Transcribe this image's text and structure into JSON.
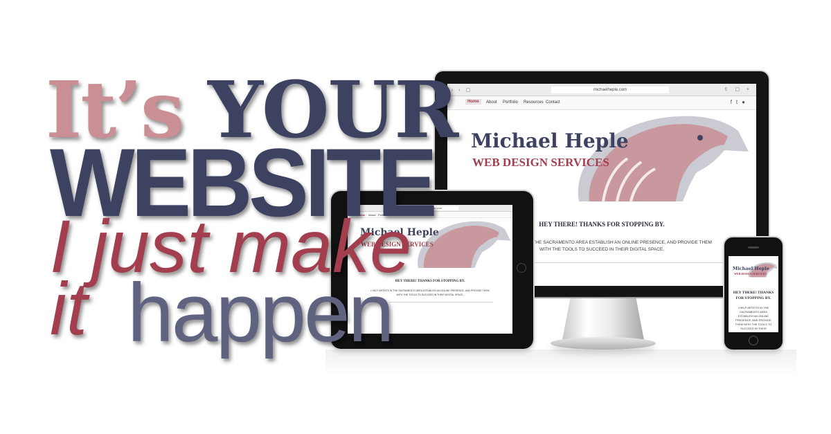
{
  "headline": {
    "part1": "It’s",
    "part2": "YOUR",
    "part3": "WEBSITE",
    "part4": "I just make",
    "part5": "it",
    "part6": "happen"
  },
  "site": {
    "url": "michaelheple.com",
    "nav": [
      "Home",
      "About",
      "Portfolio",
      "Resources",
      "Contact"
    ],
    "social_icons": [
      "facebook-icon",
      "twitter-icon",
      "github-icon"
    ],
    "title": "Michael Heple",
    "subtitle": "WEB DESIGN SERVICES",
    "greeting": "HEY THERE! THANKS FOR STOPPING BY.",
    "greeting_phone_line1": "HEY THERE! THANKS",
    "greeting_phone_line2": "FOR STOPPING BY.",
    "intro_monitor_line1": "I HELP ARTISTS IN THE SACRAMENTO AREA ESTABLISH AN ONLINE PRESENCE, AND PROVIDE THEM",
    "intro_monitor_line2": "WITH THE TOOLS TO SUCCEED IN THEIR DIGITAL SPACE.",
    "intro_phone": "I HELP ARTISTS IN THE SACRAMENTO AREA ESTABLISH AN ONLINE PRESENCE, AND PROVIDE THEM WITH THE TOOLS TO SUCCEED IN THEIR"
  },
  "colors": {
    "navy": "#3d4260",
    "rose": "#c98f94",
    "crimson": "#a23e4d",
    "slate": "#5f6380"
  }
}
